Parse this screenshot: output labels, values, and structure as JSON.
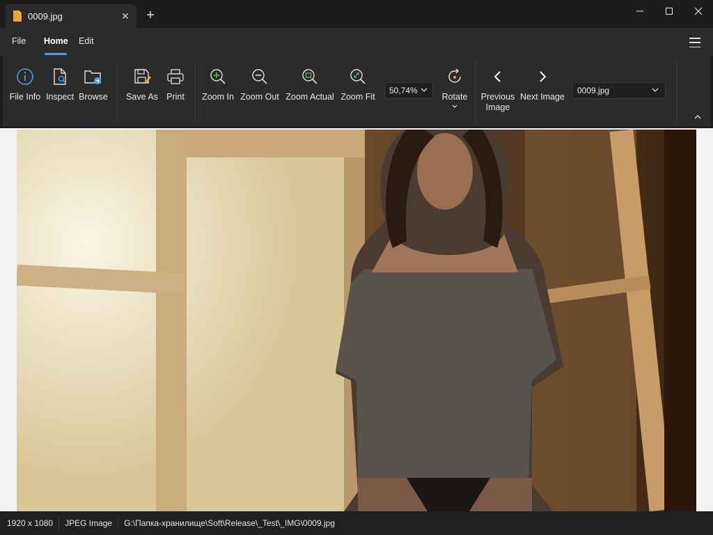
{
  "window": {
    "tab_title": "0009.jpg",
    "new_tab_symbol": "+",
    "close_tab_symbol": "✕"
  },
  "menu": {
    "file": "File",
    "home": "Home",
    "edit": "Edit"
  },
  "ribbon": {
    "file_info": "File Info",
    "inspect": "Inspect",
    "browse": "Browse",
    "save_as": "Save As",
    "print": "Print",
    "zoom_in": "Zoom In",
    "zoom_out": "Zoom Out",
    "zoom_actual": "Zoom Actual",
    "zoom_fit": "Zoom Fit",
    "zoom_level": "50,74%",
    "rotate": "Rotate",
    "previous_image": "Previous\nImage",
    "previous_image_line1": "Previous",
    "previous_image_line2": "Image",
    "next_image": "Next Image",
    "current_file": "0009.jpg"
  },
  "status": {
    "dimensions": "1920 x 1080",
    "file_type": "JPEG Image",
    "path": "G:\\Папка-хранилище\\Soft\\Release\\_Test\\_IMG\\0009.jpg"
  },
  "colors": {
    "accent": "#4aa0e6",
    "icon_blue": "#4aa0e6",
    "icon_green": "#5cc06a",
    "folder_orange": "#f0a23a",
    "background": "#1c1c1c",
    "ribbon": "#2b2b2b"
  }
}
